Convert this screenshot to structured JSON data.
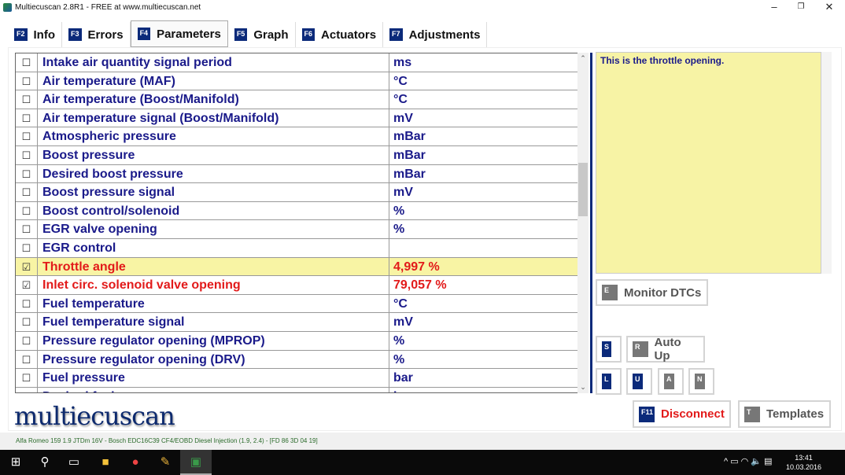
{
  "window": {
    "title": "Multiecuscan 2.8R1 - FREE at www.multiecuscan.net",
    "minimize": "–",
    "restore": "❐",
    "close": "✕"
  },
  "tabs": [
    {
      "key": "F2",
      "label": "Info"
    },
    {
      "key": "F3",
      "label": "Errors"
    },
    {
      "key": "F4",
      "label": "Parameters",
      "active": true
    },
    {
      "key": "F5",
      "label": "Graph"
    },
    {
      "key": "F6",
      "label": "Actuators"
    },
    {
      "key": "F7",
      "label": "Adjustments"
    }
  ],
  "parameters": [
    {
      "checked": false,
      "name": "Intake air quantity signal period",
      "value": "ms"
    },
    {
      "checked": false,
      "name": "Air temperature (MAF)",
      "value": "°C"
    },
    {
      "checked": false,
      "name": "Air temperature (Boost/Manifold)",
      "value": "°C"
    },
    {
      "checked": false,
      "name": "Air temperature signal (Boost/Manifold)",
      "value": "mV"
    },
    {
      "checked": false,
      "name": "Atmospheric pressure",
      "value": "mBar"
    },
    {
      "checked": false,
      "name": "Boost pressure",
      "value": "mBar"
    },
    {
      "checked": false,
      "name": "Desired boost pressure",
      "value": "mBar"
    },
    {
      "checked": false,
      "name": "Boost pressure signal",
      "value": "mV"
    },
    {
      "checked": false,
      "name": "Boost control/solenoid",
      "value": "%"
    },
    {
      "checked": false,
      "name": "EGR valve opening",
      "value": "%"
    },
    {
      "checked": false,
      "name": "EGR control",
      "value": ""
    },
    {
      "checked": true,
      "name": "Throttle angle",
      "value": "4,997 %",
      "selected": true
    },
    {
      "checked": true,
      "name": "Inlet circ. solenoid valve opening",
      "value": "79,057 %"
    },
    {
      "checked": false,
      "name": "Fuel temperature",
      "value": "°C"
    },
    {
      "checked": false,
      "name": "Fuel temperature signal",
      "value": "mV"
    },
    {
      "checked": false,
      "name": "Pressure regulator opening (MPROP)",
      "value": "%"
    },
    {
      "checked": false,
      "name": "Pressure regulator opening (DRV)",
      "value": "%"
    },
    {
      "checked": false,
      "name": "Fuel pressure",
      "value": "bar"
    },
    {
      "checked": false,
      "name": "Desired fuel pressure",
      "value": "bar"
    }
  ],
  "description": "This is the throttle opening.",
  "buttons": {
    "monitor_dtcs": {
      "key": "E",
      "label": "Monitor DTCs"
    },
    "s": {
      "key": "S"
    },
    "auto_up": {
      "key": "R",
      "label": "Auto Up"
    },
    "l": {
      "key": "L"
    },
    "u": {
      "key": "U"
    },
    "a": {
      "key": "A"
    },
    "n": {
      "key": "N"
    },
    "disconnect": {
      "key": "F11",
      "label": "Disconnect"
    },
    "templates": {
      "key": "T",
      "label": "Templates"
    }
  },
  "logo": "multiecuscan",
  "status": "Alfa Romeo 159 1.9 JTDm 16V - Bosch EDC16C39 CF4/EOBD Diesel Injection (1.9, 2.4) - [FD 86 3D 04 19]",
  "taskbar": {
    "time": "13:41",
    "date": "10.03.2016"
  }
}
